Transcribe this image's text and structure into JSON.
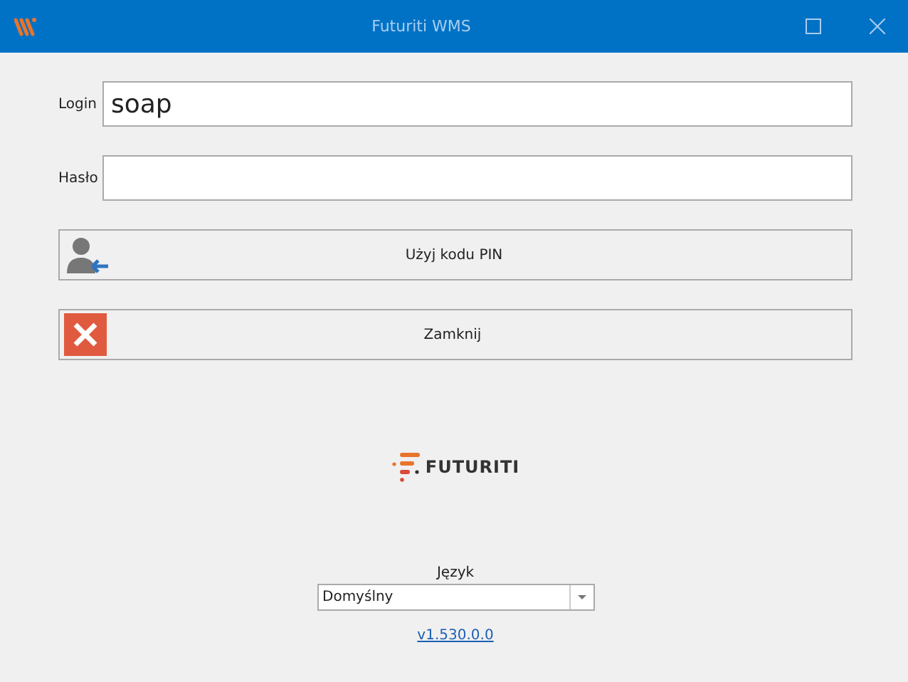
{
  "window": {
    "title": "Futuriti WMS"
  },
  "fields": [
    {
      "label": "Login",
      "value": "soap",
      "kind": "text"
    },
    {
      "label": "Hasło",
      "kind": "password"
    }
  ],
  "buttons": [
    {
      "label": "Użyj kodu PIN",
      "kind": "pin"
    },
    {
      "label": "Zamknij",
      "kind": "close"
    }
  ],
  "logo": {
    "text": "FUTURITI"
  },
  "language": {
    "label": "Język",
    "value": "Domyślny"
  },
  "version": "v1.530.0.0"
}
